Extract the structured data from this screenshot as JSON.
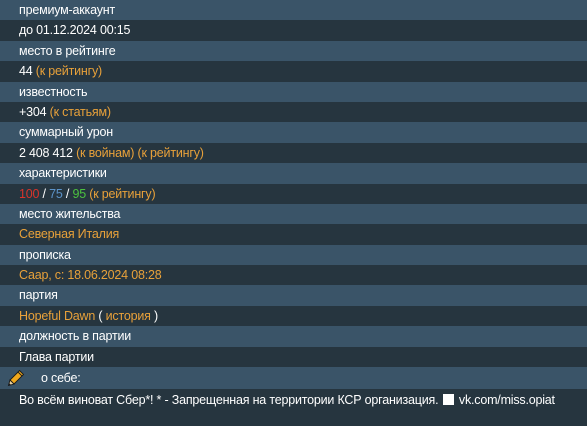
{
  "premium": {
    "label": "премиум-аккаунт",
    "until": "до 01.12.2024 00:15"
  },
  "rating": {
    "label": "место в рейтинге",
    "value": "44",
    "link": "(к рейтингу)"
  },
  "fame": {
    "label": "известность",
    "value": "+304",
    "link": "(к статьям)"
  },
  "damage": {
    "label": "суммарный урон",
    "value": "2 408 412",
    "link_wars": "(к войнам)",
    "link_rating": "(к рейтингу)"
  },
  "stats": {
    "label": "характеристики",
    "strength": "100",
    "sep1": " / ",
    "education": "75",
    "sep2": " / ",
    "endurance": "95",
    "link": "(к рейтингу)"
  },
  "residence": {
    "label": "место жительства",
    "value": "Северная Италия"
  },
  "registration": {
    "label": "прописка",
    "value": "Саар, с: 18.06.2024 08:28"
  },
  "party": {
    "label": "партия",
    "name": "Hopeful Dawn",
    "open_paren": " ( ",
    "history": "история",
    "close_paren": " )"
  },
  "party_position": {
    "label": "должность в партии",
    "value": "Глава партии"
  },
  "about": {
    "label": "о себе:",
    "text_part1": "Во всём виноват Сбер*! * - Запрещенная на территории КСР организация.",
    "text_part2": "vk.com/miss.opiat",
    "icon": "pencil-icon"
  },
  "colors": {
    "header_bg": "#3a5468",
    "body_bg": "#26353f",
    "link": "#e8a13a",
    "strength": "#d9342b",
    "education": "#5c93c9",
    "endurance": "#4cc23f"
  }
}
